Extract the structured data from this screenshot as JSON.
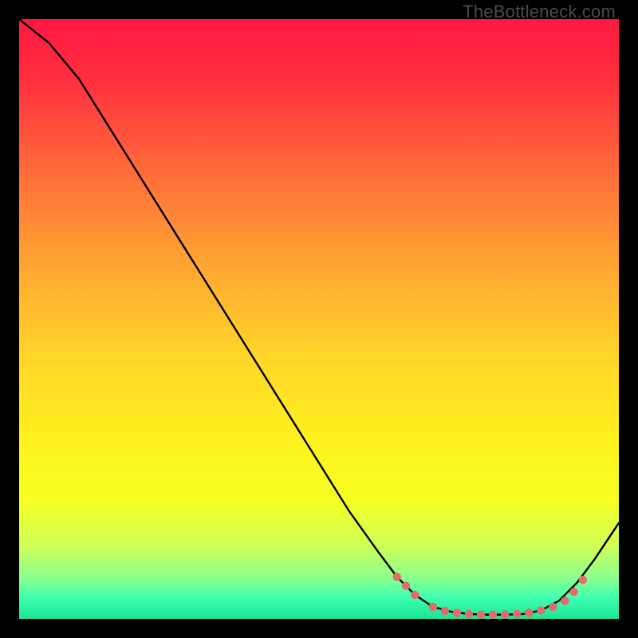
{
  "watermark": "TheBottleneck.com",
  "colors": {
    "bg": "#000000",
    "marker": "#e66a6a",
    "line": "#000000",
    "gradient_stops": [
      {
        "offset": 0.0,
        "color": "#ff1842"
      },
      {
        "offset": 0.1,
        "color": "#ff2f3f"
      },
      {
        "offset": 0.25,
        "color": "#ff6a3a"
      },
      {
        "offset": 0.4,
        "color": "#ffa233"
      },
      {
        "offset": 0.55,
        "color": "#ffd22a"
      },
      {
        "offset": 0.7,
        "color": "#fff11f"
      },
      {
        "offset": 0.8,
        "color": "#f7ff20"
      },
      {
        "offset": 0.88,
        "color": "#ceff58"
      },
      {
        "offset": 0.93,
        "color": "#8dff8d"
      },
      {
        "offset": 0.965,
        "color": "#3fffb0"
      },
      {
        "offset": 1.0,
        "color": "#19e696"
      }
    ]
  },
  "chart_data": {
    "type": "line",
    "title": "",
    "xlabel": "",
    "ylabel": "",
    "xlim": [
      0,
      100
    ],
    "ylim": [
      0,
      100
    ],
    "grid": false,
    "series": [
      {
        "name": "curve",
        "x": [
          0,
          5,
          10,
          15,
          20,
          25,
          30,
          35,
          40,
          45,
          50,
          55,
          60,
          63,
          66,
          69,
          72,
          75,
          78,
          81,
          84,
          87,
          90,
          93,
          96,
          100
        ],
        "y": [
          100,
          96,
          90,
          82,
          74,
          66,
          58,
          50,
          42,
          34,
          26,
          18,
          11,
          7,
          4,
          2,
          1.2,
          0.8,
          0.7,
          0.7,
          0.8,
          1.4,
          3,
          6,
          10,
          16
        ]
      }
    ],
    "markers": {
      "name": "highlight-points",
      "x": [
        63,
        64.5,
        66,
        69,
        71,
        73,
        75,
        77,
        79,
        81,
        83,
        85,
        87,
        89,
        91,
        92.5,
        94
      ],
      "y": [
        7,
        5.5,
        4,
        2,
        1.3,
        1.0,
        0.8,
        0.7,
        0.7,
        0.7,
        0.8,
        1.0,
        1.4,
        2.0,
        3.0,
        4.5,
        6.5
      ]
    }
  }
}
